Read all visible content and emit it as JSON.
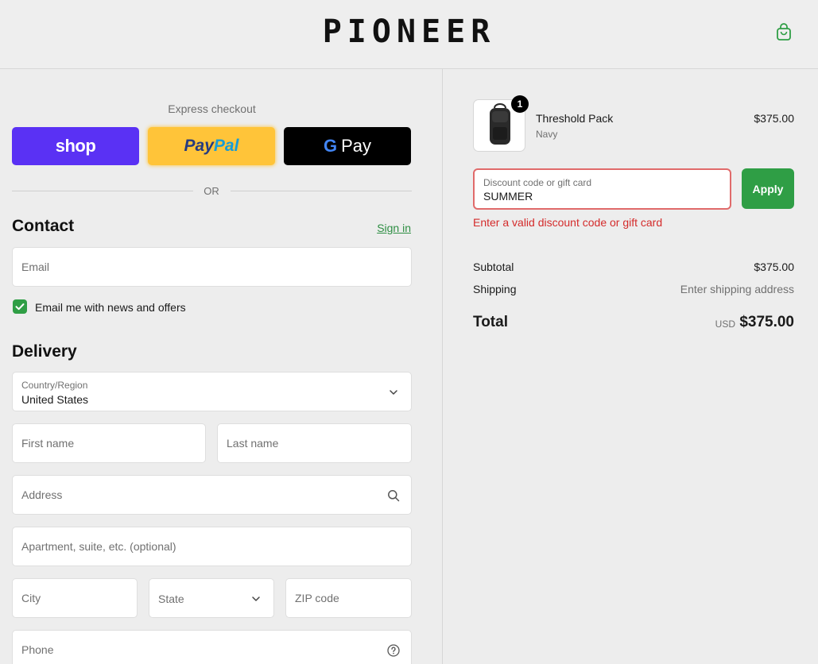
{
  "header": {
    "brand": "PIONEER",
    "cart_icon": "shopping-bag-icon"
  },
  "express": {
    "label": "Express checkout",
    "shop_label": "shop",
    "paypal_part1": "Pay",
    "paypal_part2": "Pal",
    "gpay_g": "G",
    "gpay_label": "Pay",
    "or_label": "OR"
  },
  "contact": {
    "title": "Contact",
    "sign_in": "Sign in",
    "email_placeholder": "Email",
    "newsletter_label": "Email me with news and offers",
    "newsletter_checked": true
  },
  "delivery": {
    "title": "Delivery",
    "country_label": "Country/Region",
    "country_value": "United States",
    "first_name_placeholder": "First name",
    "last_name_placeholder": "Last name",
    "address_placeholder": "Address",
    "apartment_placeholder": "Apartment, suite, etc. (optional)",
    "city_placeholder": "City",
    "state_label": "State",
    "zip_placeholder": "ZIP code",
    "phone_placeholder": "Phone"
  },
  "order": {
    "item": {
      "name": "Threshold Pack",
      "variant": "Navy",
      "price": "$375.00",
      "quantity": "1"
    },
    "discount": {
      "label": "Discount code or gift card",
      "value": "SUMMER",
      "apply_label": "Apply",
      "error": "Enter a valid discount code or gift card"
    },
    "subtotal_label": "Subtotal",
    "subtotal_value": "$375.00",
    "shipping_label": "Shipping",
    "shipping_value": "Enter shipping address",
    "total_label": "Total",
    "total_currency": "USD",
    "total_value": "$375.00"
  },
  "colors": {
    "accent": "#2f9e45",
    "error": "#d42b2b",
    "shop_purple": "#5a31f4",
    "paypal_yellow": "#ffc439"
  }
}
